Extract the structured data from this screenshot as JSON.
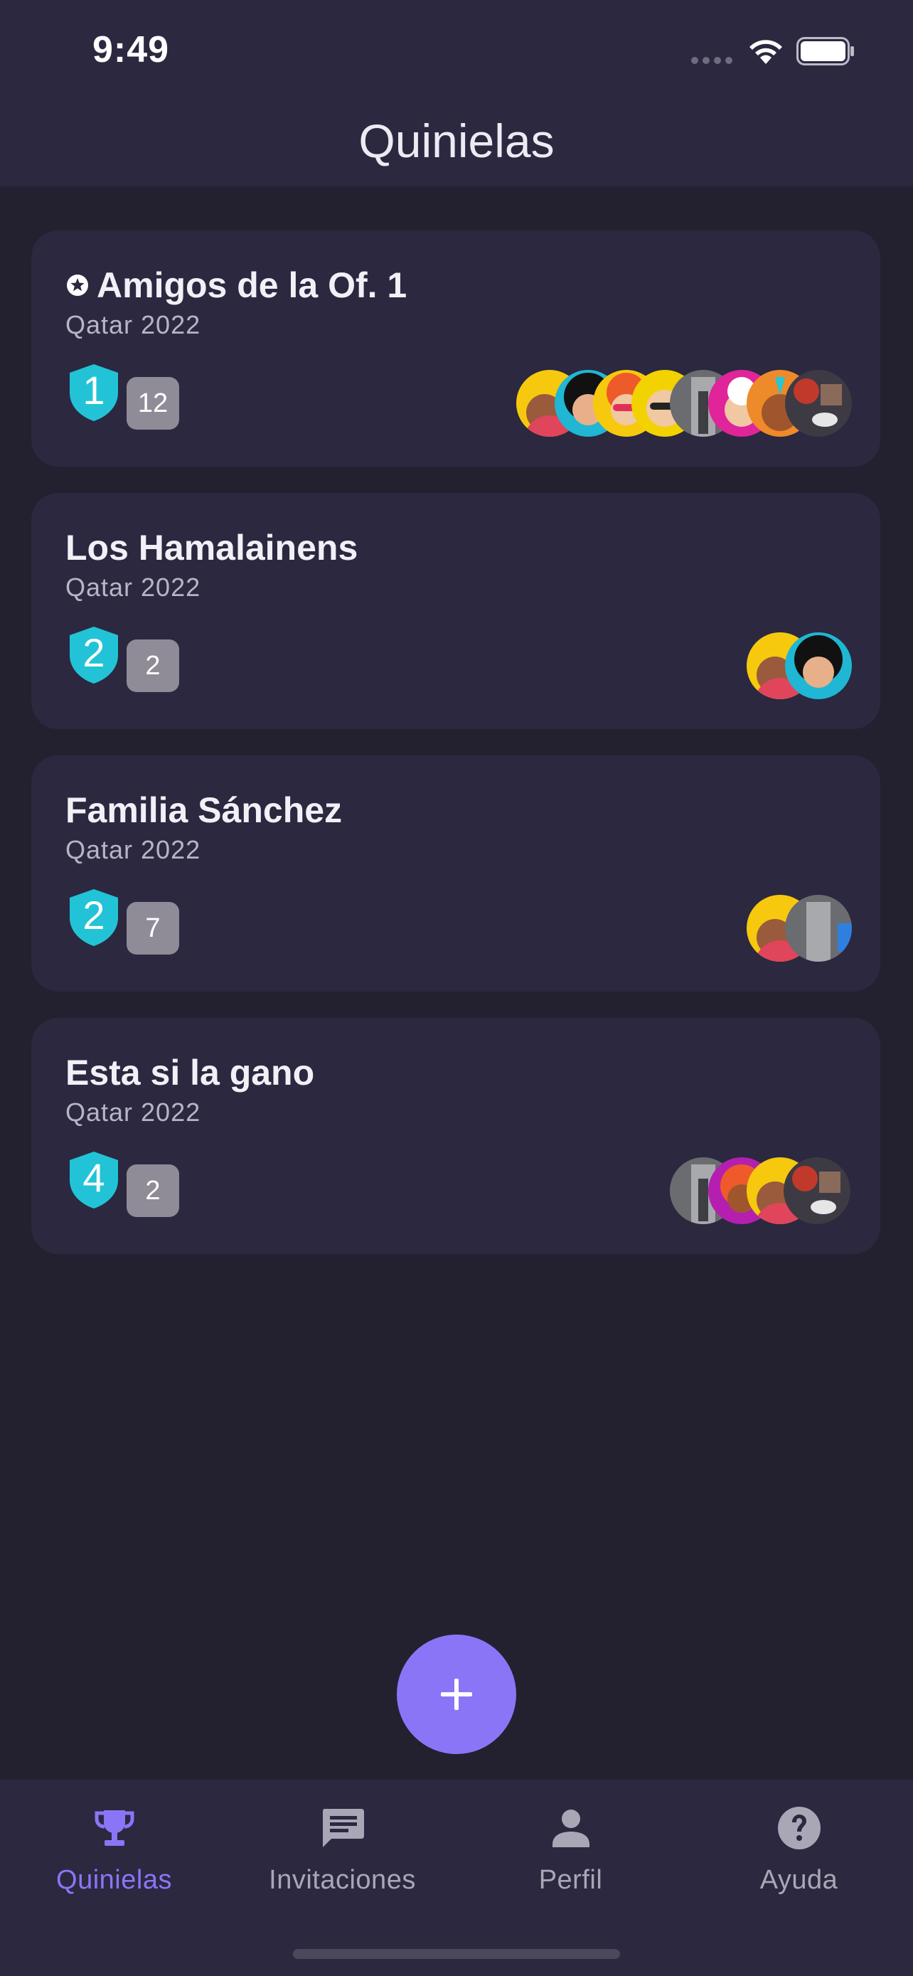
{
  "status_bar": {
    "time": "9:49"
  },
  "header": {
    "title": "Quinielas"
  },
  "groups": [
    {
      "name": "Amigos de la Of. 1",
      "starred": true,
      "tournament": "Qatar 2022",
      "rank": "1",
      "members": "12"
    },
    {
      "name": "Los Hamalainens",
      "starred": false,
      "tournament": "Qatar 2022",
      "rank": "2",
      "members": "2"
    },
    {
      "name": "Familia Sánchez",
      "starred": false,
      "tournament": "Qatar 2022",
      "rank": "2",
      "members": "7"
    },
    {
      "name": "Esta si la gano",
      "starred": false,
      "tournament": "Qatar 2022",
      "rank": "4",
      "members": "2"
    }
  ],
  "fab": {
    "icon": "plus-icon"
  },
  "tabs": [
    {
      "label": "Quinielas",
      "icon": "trophy-icon",
      "active": true
    },
    {
      "label": "Invitaciones",
      "icon": "chat-icon",
      "active": false
    },
    {
      "label": "Perfil",
      "icon": "person-icon",
      "active": false
    },
    {
      "label": "Ayuda",
      "icon": "help-icon",
      "active": false
    }
  ],
  "colors": {
    "accent": "#8b75f7",
    "rank_shield": "#22c3d6",
    "card": "#2b2840",
    "background": "#23212f"
  }
}
